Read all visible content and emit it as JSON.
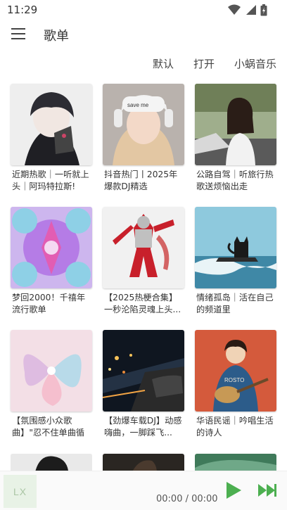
{
  "status_bar": {
    "time": "11:29",
    "icons": [
      "wifi-icon",
      "cellular-signal-icon",
      "battery-icon"
    ]
  },
  "app_bar": {
    "menu_icon": "hamburger-menu-icon",
    "title": "歌单"
  },
  "sort_options": [
    {
      "label": "默认"
    },
    {
      "label": "打开"
    },
    {
      "label": "小蜗音乐"
    }
  ],
  "playlists": [
    {
      "title": "近期热歌｜一听就上头｜阿玛特拉斯!"
    },
    {
      "title": "抖音热门丨2025年爆款DJ精选"
    },
    {
      "title": "公路自驾｜听旅行热歌送烦恼出走"
    },
    {
      "title": "梦回2000！千禧年流行歌单"
    },
    {
      "title": "【2025热梗合集】一秒沦陷灵魂上头..."
    },
    {
      "title": "情绪孤岛｜活在自己的频道里"
    },
    {
      "title": "【氛围感小众歌曲】\"忍不住单曲循环！\""
    },
    {
      "title": "【劲爆车载DJ】动感嗨曲，一脚踩飞..."
    },
    {
      "title": "华语民谣｜吟唱生活的诗人"
    }
  ],
  "player": {
    "cover_text": "LX",
    "time": "00:00 / 00:00",
    "play_icon": "play-icon",
    "next_icon": "skip-next-icon"
  },
  "colors": {
    "accent": "#4caf50",
    "text": "#333333",
    "player_bg": "#fafafa"
  }
}
